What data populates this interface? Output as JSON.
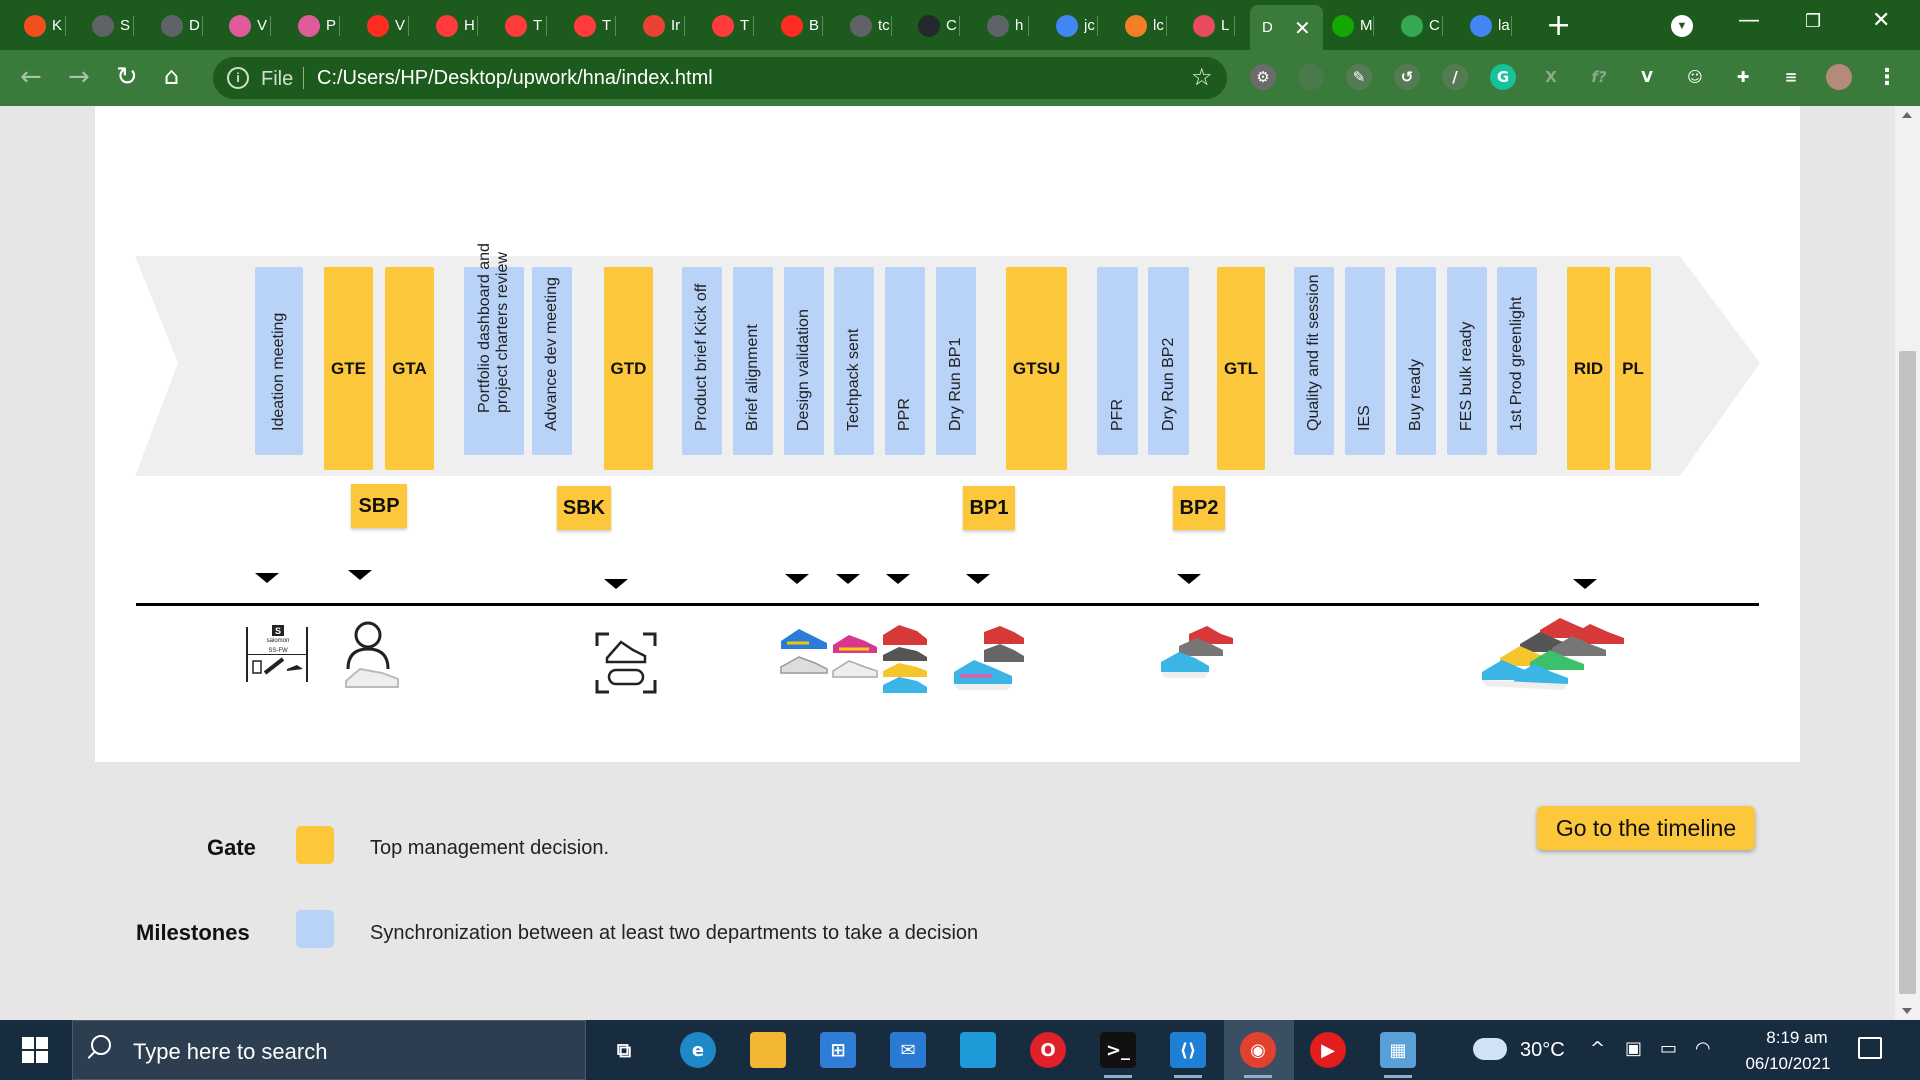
{
  "browser": {
    "tabs": [
      {
        "title": "K",
        "icon": "figma-icon",
        "color": "#f24e1e"
      },
      {
        "title": "S",
        "icon": "globe-icon",
        "color": "#5f6368"
      },
      {
        "title": "D",
        "icon": "globe-icon",
        "color": "#5f6368"
      },
      {
        "title": "V",
        "icon": "octopus-icon",
        "color": "#e05b9a"
      },
      {
        "title": "P",
        "icon": "octopus-icon",
        "color": "#e05b9a"
      },
      {
        "title": "V",
        "icon": "laravel-icon",
        "color": "#ff2d20"
      },
      {
        "title": "H",
        "icon": "target-icon",
        "color": "#ff3b3b"
      },
      {
        "title": "T",
        "icon": "target-icon",
        "color": "#ff3b3b"
      },
      {
        "title": "T",
        "icon": "target-icon",
        "color": "#ff3b3b"
      },
      {
        "title": "Ir",
        "icon": "gmail-icon",
        "color": "#ea4335"
      },
      {
        "title": "T",
        "icon": "target-icon",
        "color": "#ff3b3b"
      },
      {
        "title": "B",
        "icon": "laravel-icon",
        "color": "#ff2d20"
      },
      {
        "title": "tc",
        "icon": "globe-icon",
        "color": "#5f6368"
      },
      {
        "title": "C",
        "icon": "github-icon",
        "color": "#24292e"
      },
      {
        "title": "h",
        "icon": "globe-icon",
        "color": "#5f6368"
      },
      {
        "title": "jc",
        "icon": "google-icon",
        "color": "#4285f4"
      },
      {
        "title": "lc",
        "icon": "stackoverflow-icon",
        "color": "#f48024"
      },
      {
        "title": "L",
        "icon": "pen-icon",
        "color": "#e84a5f"
      },
      {
        "title": "D",
        "icon": "",
        "color": "#3a7a3a",
        "active": true
      },
      {
        "title": "M",
        "icon": "upwork-icon",
        "color": "#14a800"
      },
      {
        "title": "C",
        "icon": "c-icon",
        "color": "#34a853"
      },
      {
        "title": "la",
        "icon": "google-icon",
        "color": "#4285f4"
      }
    ],
    "scheme_label": "File",
    "url": "C:/Users/HP/Desktop/upwork/hna/index.html"
  },
  "timeline": {
    "steps": [
      {
        "label": "Ideation meeting",
        "type": "milestone"
      },
      {
        "label": "GTE",
        "type": "gate"
      },
      {
        "label": "GTA",
        "type": "gate"
      },
      {
        "label": "Portfolio dashboard and project charters review",
        "type": "milestone"
      },
      {
        "label": "Advance dev meeting",
        "type": "milestone"
      },
      {
        "label": "GTD",
        "type": "gate"
      },
      {
        "label": "Product brief Kick off",
        "type": "milestone"
      },
      {
        "label": "Brief alignment",
        "type": "milestone"
      },
      {
        "label": "Design validation",
        "type": "milestone"
      },
      {
        "label": "Techpack sent",
        "type": "milestone"
      },
      {
        "label": "PPR",
        "type": "milestone"
      },
      {
        "label": "Dry Run BP1",
        "type": "milestone"
      },
      {
        "label": "GTSU",
        "type": "gate"
      },
      {
        "label": "PFR",
        "type": "milestone"
      },
      {
        "label": "Dry Run BP2",
        "type": "milestone"
      },
      {
        "label": "GTL",
        "type": "gate"
      },
      {
        "label": "Quality and fit session",
        "type": "milestone"
      },
      {
        "label": "IES",
        "type": "milestone"
      },
      {
        "label": "Buy ready",
        "type": "milestone"
      },
      {
        "label": "FES bulk ready",
        "type": "milestone"
      },
      {
        "label": "1st Prod greenlight",
        "type": "milestone"
      },
      {
        "label": "RID",
        "type": "gate"
      },
      {
        "label": "PL",
        "type": "gate"
      }
    ],
    "phases": [
      "SBP",
      "SBK",
      "BP1",
      "BP2"
    ],
    "illustration_brand_text": "salomon",
    "illustration_season_text": "SS-FW"
  },
  "legend": {
    "gate_label": "Gate",
    "gate_desc": "Top management decision.",
    "milestone_label": "Milestones",
    "milestone_desc": "Synchronization between at least two departments to take a decision",
    "gate_color": "#fdc73b",
    "milestone_color": "#b8d3f7"
  },
  "cta": {
    "label": "Go to the timeline"
  },
  "taskbar": {
    "search_placeholder": "Type here to search",
    "weather": "30°C",
    "time": "8:19 am",
    "date": "06/10/2021"
  }
}
